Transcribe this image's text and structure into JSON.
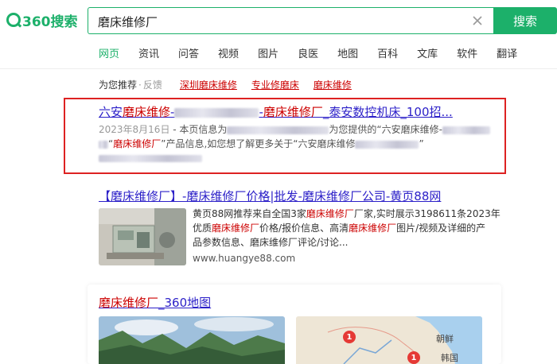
{
  "logo": {
    "text": "360搜索"
  },
  "search": {
    "value": "磨床维修厂",
    "button_label": "搜索"
  },
  "tabs": [
    {
      "label": "网页",
      "active": true
    },
    {
      "label": "资讯"
    },
    {
      "label": "问答"
    },
    {
      "label": "视频"
    },
    {
      "label": "图片"
    },
    {
      "label": "良医"
    },
    {
      "label": "地图"
    },
    {
      "label": "百科"
    },
    {
      "label": "文库"
    },
    {
      "label": "软件"
    },
    {
      "label": "翻译"
    }
  ],
  "recommend": {
    "label": "为您推荐",
    "separator": "·",
    "feedback": "反馈",
    "links": [
      "深圳磨床维修",
      "专业修磨床",
      "磨床维修"
    ]
  },
  "result1": {
    "title_a": "六安",
    "title_b": "磨床维修",
    "title_c": "-",
    "title_d": "-",
    "title_e": "磨床维修厂",
    "title_f": "_泰安数控机床_100招...",
    "date": "2023年8月16日",
    "desc_a": " - 本页信息为",
    "desc_b": "为您提供的“六安磨床维修-",
    "desc_c": "“",
    "desc_d": "磨床维修厂",
    "desc_e": "”产品信息,如您想了解更多关于“六安磨床维修",
    "desc_f": "”"
  },
  "result2": {
    "title": "【磨床维修厂】-磨床维修厂价格|批发-磨床维修厂公司-黄页88网",
    "desc_1a": "黄页88网推荐来自全国3家",
    "desc_1b": "磨床维修厂",
    "desc_1c": "厂家,实时展示3198611条2023年",
    "desc_2a": "优质",
    "desc_2b": "磨床维修厂",
    "desc_2c": "价格/报价信息、高清",
    "desc_2d": "磨床维修厂",
    "desc_2e": "图片/视频及详细的产",
    "desc_3": "品参数信息、磨床维修厂评论/讨论...",
    "url": "www.huangye88.com"
  },
  "map_result": {
    "title_a": "磨床维修厂",
    "title_b": "_360地图",
    "pins": [
      "1",
      "1"
    ],
    "labels": [
      "朝鲜",
      "韩国"
    ]
  },
  "colors": {
    "accent": "#1cb06a",
    "link": "#2b1fc8",
    "highlight": "#cc0000",
    "frame": "#dd2222"
  }
}
